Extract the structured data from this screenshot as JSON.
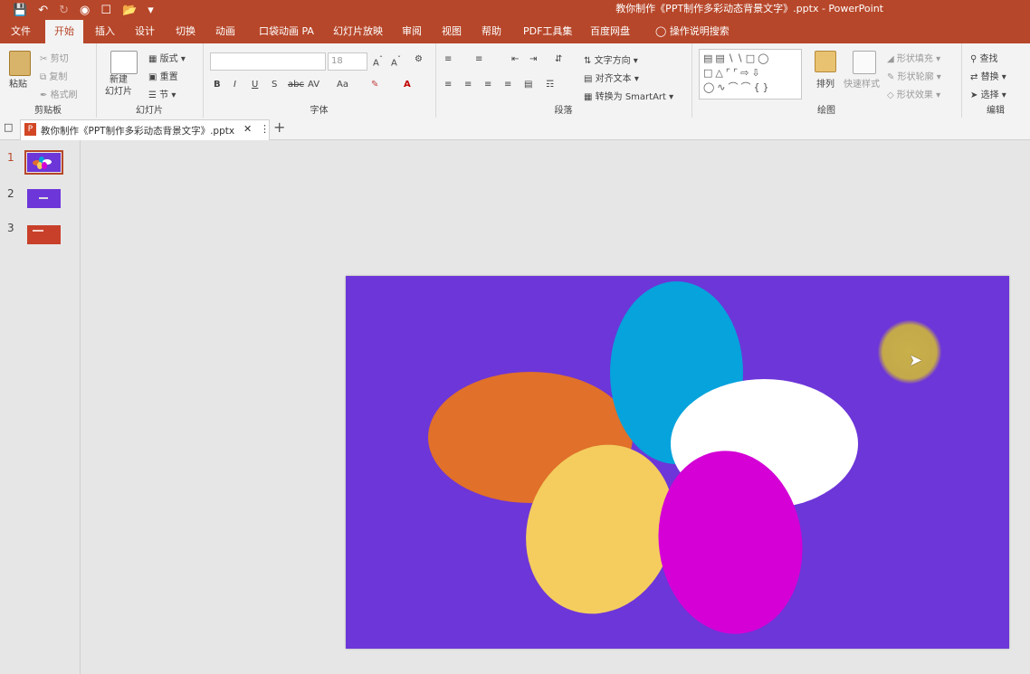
{
  "quick_access": {
    "save_icon": "save-icon",
    "undo_icon": "undo-icon",
    "redo_icon": "redo-icon",
    "present_icon": "present-icon",
    "new_icon": "new-file-icon",
    "open_icon": "open-icon",
    "customize_icon": "customize-icon"
  },
  "window": {
    "title": "教你制作《PPT制作多彩动态背景文字》.pptx  -  PowerPoint"
  },
  "tabs": [
    "文件",
    "开始",
    "插入",
    "设计",
    "切换",
    "动画",
    "口袋动画 PA",
    "幻灯片放映",
    "审阅",
    "视图",
    "帮助",
    "PDF工具集",
    "百度网盘",
    "操作说明搜索"
  ],
  "ribbon": {
    "clipboard": {
      "paste": "粘贴",
      "cut": "剪切",
      "copy": "复制",
      "format_painter": "格式刷",
      "label": "剪贴板"
    },
    "slides": {
      "new_slide": "新建\n幻灯片",
      "layout": "版式",
      "reset": "重置",
      "section": "节",
      "label": "幻灯片"
    },
    "font": {
      "font_size": "18",
      "bold": "B",
      "italic": "I",
      "underline": "U",
      "shadow": "S",
      "strike": "abc",
      "spacing": "AV",
      "case": "Aa",
      "color": "A",
      "label": "字体"
    },
    "paragraph": {
      "text_direction": "文字方向",
      "align_text": "对齐文本",
      "smartart": "转换为 SmartArt",
      "label": "段落"
    },
    "drawing": {
      "arrange": "排列",
      "quick_styles": "快速样式",
      "shape_fill": "形状填充",
      "shape_outline": "形状轮廓",
      "shape_effects": "形状效果",
      "label": "绘图"
    },
    "editing": {
      "find": "查找",
      "replace": "替换",
      "select": "选择",
      "label": "编辑"
    }
  },
  "document_tab": {
    "name": "教你制作《PPT制作多彩动态背景文字》.pptx"
  },
  "thumbnails": [
    {
      "number": "1"
    },
    {
      "number": "2"
    },
    {
      "number": "3"
    }
  ],
  "colors": {
    "accent": "#b7472a",
    "slide_bg": "#6d36d8",
    "orange": "#e0702a",
    "blue": "#06a3dc",
    "white": "#ffffff",
    "yellow": "#f4cd5e",
    "magenta": "#d400d6"
  }
}
